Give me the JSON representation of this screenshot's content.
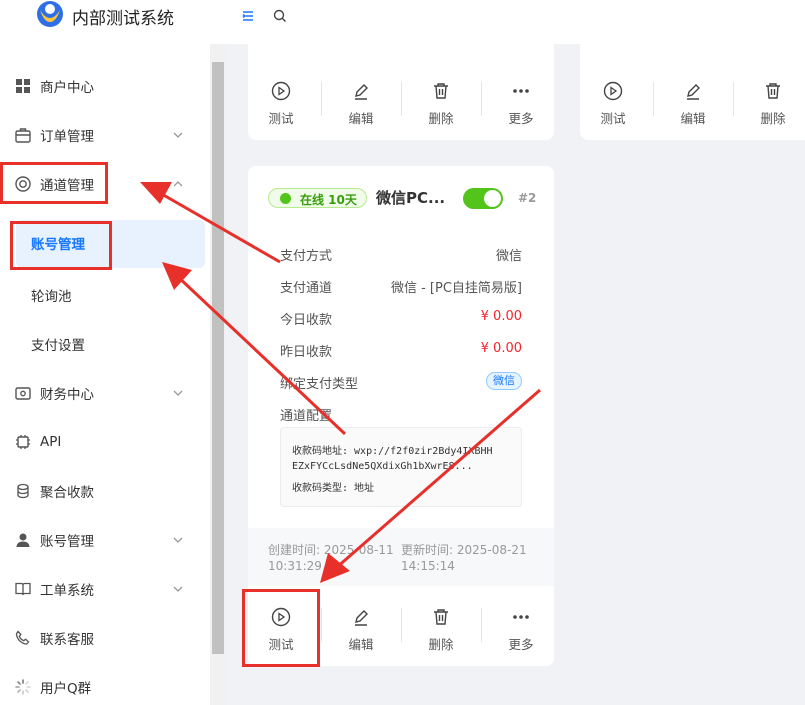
{
  "app": {
    "title": "内部测试系统"
  },
  "sidebar": {
    "items": [
      {
        "label": "商户中心",
        "icon": "grid-icon",
        "expandable": false
      },
      {
        "label": "订单管理",
        "icon": "briefcase-icon",
        "expandable": true,
        "expanded": false
      },
      {
        "label": "通道管理",
        "icon": "lifebuoy-icon",
        "expandable": true,
        "expanded": true,
        "children": [
          {
            "label": "账号管理",
            "active": true
          },
          {
            "label": "轮询池"
          },
          {
            "label": "支付设置"
          }
        ]
      },
      {
        "label": "财务中心",
        "icon": "wallet-icon",
        "expandable": true,
        "expanded": false
      },
      {
        "label": "API",
        "icon": "chip-icon",
        "expandable": false
      },
      {
        "label": "聚合收款",
        "icon": "aggregate-icon",
        "expandable": false
      },
      {
        "label": "账号管理",
        "icon": "user-icon",
        "expandable": true,
        "expanded": false
      },
      {
        "label": "工单系统",
        "icon": "book-icon",
        "expandable": true,
        "expanded": false
      },
      {
        "label": "联系客服",
        "icon": "phone-icon",
        "expandable": false
      },
      {
        "label": "用户Q群",
        "icon": "loading-icon",
        "expandable": false
      }
    ]
  },
  "actions": {
    "test": "测试",
    "edit": "编辑",
    "delete": "删除",
    "more": "更多"
  },
  "card": {
    "status": "在线 10天",
    "title": "微信PC...",
    "number": "#2",
    "enabled": true,
    "rows": [
      {
        "label": "支付方式",
        "value": "微信"
      },
      {
        "label": "支付通道",
        "value": "微信 - [PC自挂简易版]"
      },
      {
        "label": "今日收款",
        "value": "¥ 0.00"
      },
      {
        "label": "昨日收款",
        "value": "¥ 0.00"
      },
      {
        "label": "绑定支付类型",
        "tag": "微信"
      },
      {
        "label": "通道配置"
      }
    ],
    "config_lines": [
      "收款码地址: wxp://f2f0zir2Bdy4IXBHH",
      "EZxFYCcLsdNe5QXdixGh1bXwrE8...",
      "收款码类型: 地址"
    ],
    "created": "创建时间: 2025-08-11",
    "created_time": "10:31:29",
    "updated": "更新时间: 2025-08-21",
    "updated_time": "14:15:14"
  },
  "colors": {
    "primary": "#1677ff",
    "online_green": "#52c41a",
    "amount_red": "#f5222d",
    "annotation_red": "#e8302b"
  }
}
